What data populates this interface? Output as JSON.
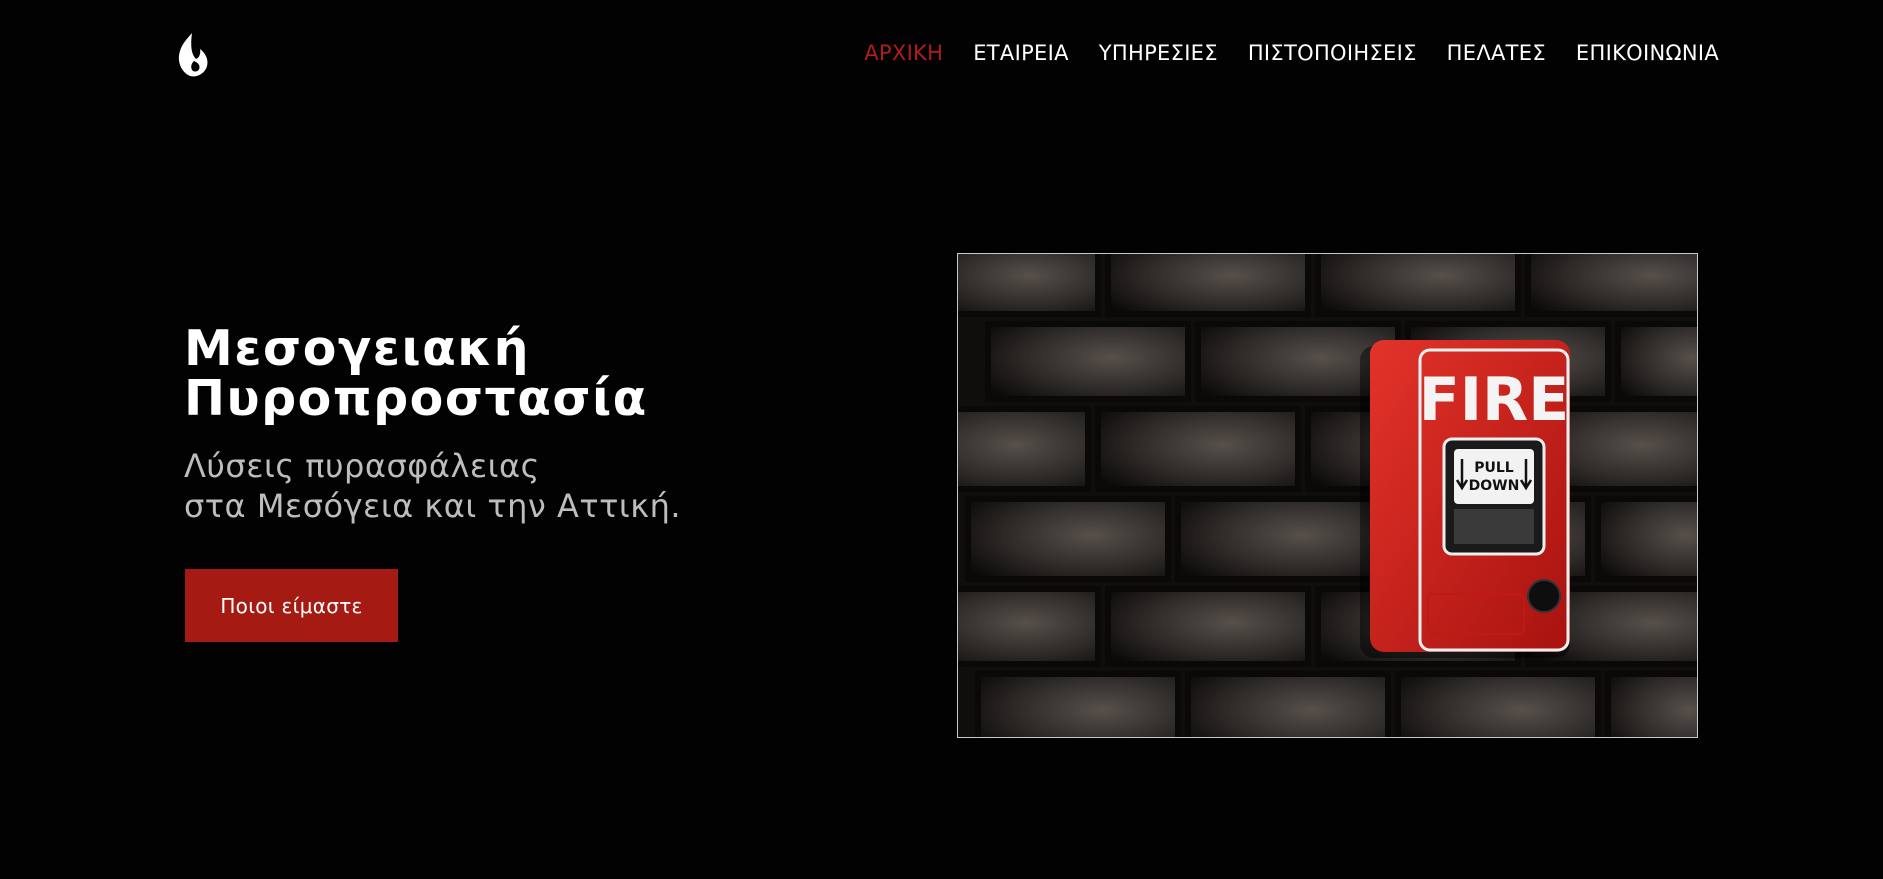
{
  "header": {
    "logo_icon": "flame-icon",
    "nav": [
      {
        "label": "ΑΡΧΙΚΗ",
        "active": true
      },
      {
        "label": "ΕΤΑΙΡΕΙΑ",
        "active": false
      },
      {
        "label": "ΥΠΗΡΕΣΙΕΣ",
        "active": false
      },
      {
        "label": "ΠΙΣΤΟΠΟΙΗΣΕΙΣ",
        "active": false
      },
      {
        "label": "ΠΕΛΑΤΕΣ",
        "active": false
      },
      {
        "label": "ΕΠΙΚΟΙΝΩΝΙΑ",
        "active": false
      }
    ]
  },
  "hero": {
    "title_line1": "Μεσογειακή",
    "title_line2": "Πυροπροστασία",
    "subtitle_line1": "Λύσεις πυρασφάλειας",
    "subtitle_line2": "στα Μεσόγεια και την Αττική.",
    "cta_label": "Ποιοι είμαστε"
  },
  "image": {
    "alarm_text": "FIRE",
    "pull_line1": "PULL",
    "pull_line2": "DOWN"
  },
  "colors": {
    "background": "#020202",
    "accent": "#a51b14",
    "nav_active": "#b01c1c",
    "text": "#ffffff",
    "subtitle": "#bdbdbd"
  }
}
